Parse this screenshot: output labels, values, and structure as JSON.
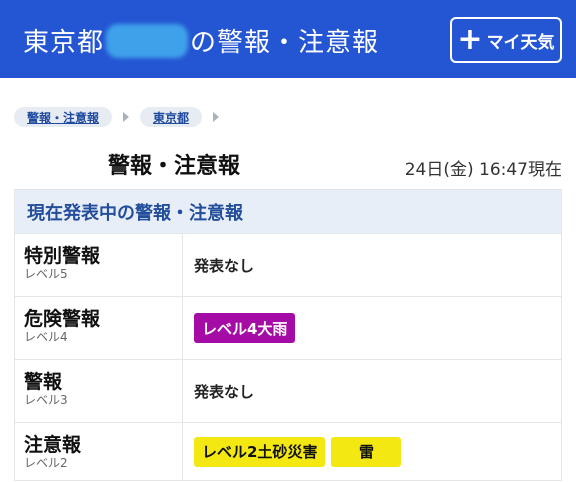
{
  "header": {
    "title_prefix": "東京都",
    "title_suffix": "の警報・注意報",
    "my_weather_button": "マイ天気",
    "plus_glyph": "+"
  },
  "breadcrumb": [
    "警報・注意報",
    "東京都"
  ],
  "page": {
    "title": "警報・注意報",
    "timestamp": "24日(金) 16:47現在"
  },
  "table": {
    "header": "現在発表中の警報・注意報",
    "rows": [
      {
        "name": "特別警報",
        "level": "レベル5",
        "status": "発表なし",
        "badges": []
      },
      {
        "name": "危険警報",
        "level": "レベル4",
        "status": "",
        "badges": [
          {
            "label": "レベル4大雨",
            "color": "#a50ca6"
          }
        ]
      },
      {
        "name": "警報",
        "level": "レベル3",
        "status": "発表なし",
        "badges": []
      },
      {
        "name": "注意報",
        "level": "レベル2",
        "status": "",
        "badges": [
          {
            "label": "レベル2土砂災害",
            "color": "#f4e813"
          },
          {
            "label": "雷",
            "color": "#f4e813"
          }
        ]
      }
    ]
  },
  "colors": {
    "header_bg": "#2456d3",
    "table_header_bg": "#e8eef7",
    "link": "#1f4aa0"
  }
}
